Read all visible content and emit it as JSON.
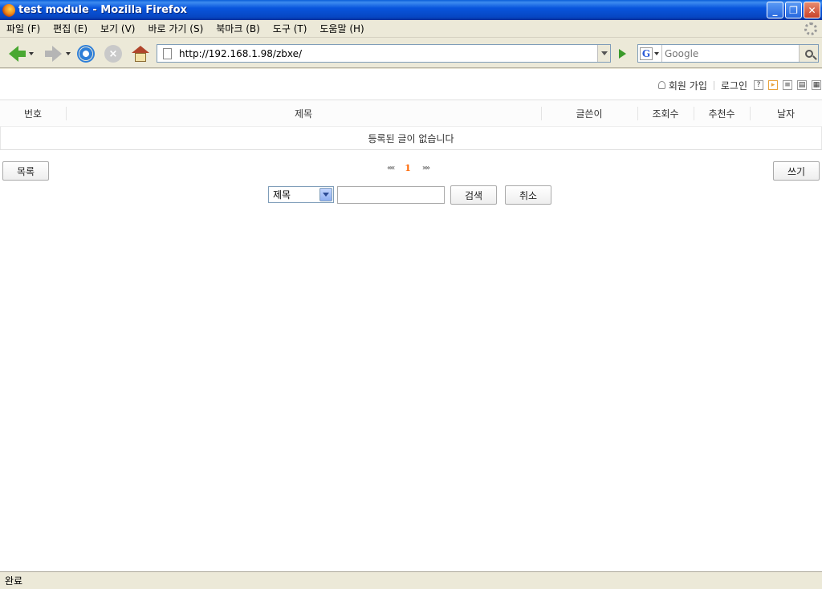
{
  "window": {
    "title": "test module - Mozilla Firefox",
    "buttons": {
      "minimize": "_",
      "restore": "❐",
      "close": "✕"
    }
  },
  "menubar": {
    "items": [
      {
        "label": "파일 (F)"
      },
      {
        "label": "편집 (E)"
      },
      {
        "label": "보기 (V)"
      },
      {
        "label": "바로 가기 (S)"
      },
      {
        "label": "북마크 (B)"
      },
      {
        "label": "도구 (T)"
      },
      {
        "label": "도움말 (H)"
      }
    ]
  },
  "navbar": {
    "url": "http://192.168.1.98/zbxe/",
    "search_placeholder": "Google",
    "search_engine_logo": "G"
  },
  "account": {
    "signup": "회원 가입",
    "login": "로그인",
    "icons": [
      "help-icon",
      "rss-icon",
      "list-view-icon",
      "webzine-view-icon",
      "gallery-view-icon"
    ],
    "help_glyph": "?"
  },
  "board": {
    "columns": [
      "번호",
      "제목",
      "글쓴이",
      "조회수",
      "추천수",
      "날자"
    ],
    "empty_message": "등록된 글이 없습니다"
  },
  "actions": {
    "list": "목록",
    "write": "쓰기"
  },
  "pagination": {
    "prev": "««",
    "current": "1",
    "next": "»»"
  },
  "search": {
    "selected_field": "제목",
    "search_button": "검색",
    "cancel_button": "취소"
  },
  "statusbar": {
    "text": "완료"
  }
}
